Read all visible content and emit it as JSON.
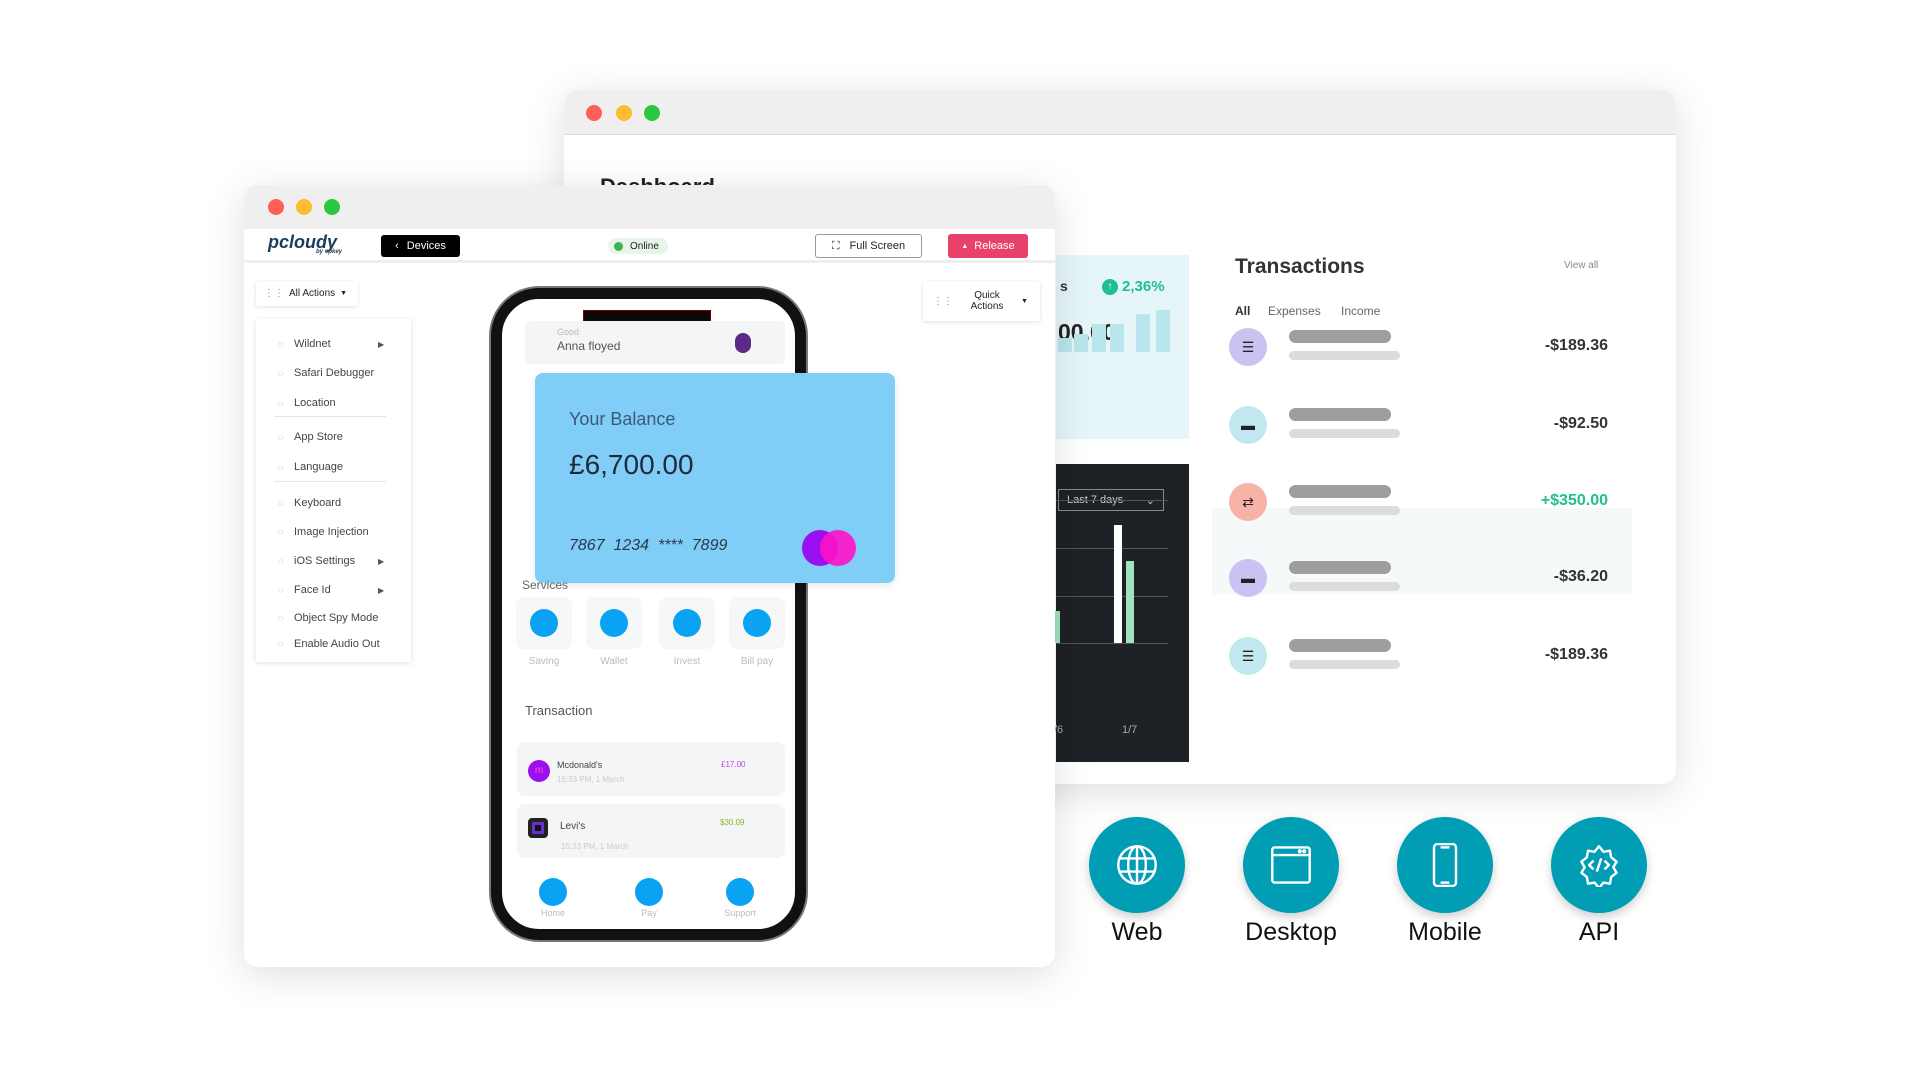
{
  "back_window": {
    "title": "Dashboard",
    "stats": {
      "label_fragment": "s",
      "change": "2,36%",
      "amount_fragment": "00.00",
      "change_color": "#1fbf8f"
    },
    "chart": {
      "range_select": "Last 7 days",
      "x_labels": [
        "/6",
        "1/7"
      ]
    },
    "transactions": {
      "title": "Transactions",
      "view_all": "View all",
      "tabs": [
        "All",
        "Expenses",
        "Income"
      ],
      "rows": [
        {
          "icon": "burger-icon",
          "icon_bg": "#c9c2f3",
          "amount": "-$189.36",
          "positive": false
        },
        {
          "icon": "store-icon",
          "icon_bg": "#bfe9ee",
          "amount": "-$92.50",
          "positive": false
        },
        {
          "icon": "transfer-icon",
          "icon_bg": "#f8b3a8",
          "amount": "+$350.00",
          "positive": true
        },
        {
          "icon": "store-icon",
          "icon_bg": "#c9c2f3",
          "amount": "-$36.20",
          "positive": false
        },
        {
          "icon": "burger-icon",
          "icon_bg": "#bfe9ee",
          "amount": "-$189.36",
          "positive": false
        }
      ]
    }
  },
  "front_window": {
    "logo": "pcloudy",
    "logo_sub": "by opkey",
    "devices_button": "Devices",
    "status": "Online",
    "fullscreen_button": "Full Screen",
    "release_button": "Release",
    "release_color": "#e8426b",
    "all_actions": "All Actions",
    "quick_actions": "Quick Actions",
    "menu": [
      {
        "label": "Wildnet",
        "icon": "fingerprint-icon",
        "submenu": true
      },
      {
        "label": "Safari Debugger",
        "icon": "bug-icon",
        "submenu": false
      },
      {
        "label": "Location",
        "icon": "location-pin-icon",
        "submenu": false
      },
      {
        "label": "App Store",
        "icon": "app-grid-icon",
        "submenu": false
      },
      {
        "label": "Language",
        "icon": "language-icon",
        "submenu": false
      },
      {
        "label": "Keyboard",
        "icon": "keyboard-icon",
        "submenu": false
      },
      {
        "label": "Image Injection",
        "icon": "image-injection-icon",
        "submenu": false
      },
      {
        "label": "iOS Settings",
        "icon": "gear-icon",
        "submenu": true
      },
      {
        "label": "Face Id",
        "icon": "face-id-icon",
        "submenu": true
      },
      {
        "label": "Object Spy Mode",
        "icon": "spy-icon",
        "submenu": false
      },
      {
        "label": "Enable Audio Out",
        "icon": "speaker-icon",
        "submenu": false
      }
    ]
  },
  "phone": {
    "greeting": "Good",
    "user_name": "Anna floyed",
    "balance_label": "Your Balance",
    "balance": "£6,700.00",
    "card_number": "7867  1234  ****  7899",
    "services_title": "Services",
    "services": [
      "Saving",
      "Wallet",
      "Invest",
      "Bill pay"
    ],
    "transaction_title": "Transaction",
    "transactions": [
      {
        "name": "Mcdonald's",
        "time": "16:33 PM, 1 March",
        "amount": "£17.00",
        "color": "#c040f0"
      },
      {
        "name": "Levi's",
        "time": "15:33 PM, 1 March",
        "amount": "$30.09",
        "color": "#8fb52a"
      }
    ],
    "nav": [
      "Home",
      "Pay",
      "Support"
    ]
  },
  "platforms": [
    {
      "label": "Web",
      "icon": "globe-icon"
    },
    {
      "label": "Desktop",
      "icon": "browser-window-icon"
    },
    {
      "label": "Mobile",
      "icon": "smartphone-icon"
    },
    {
      "label": "API",
      "icon": "api-gear-code-icon"
    }
  ],
  "platform_color": "#009db5"
}
